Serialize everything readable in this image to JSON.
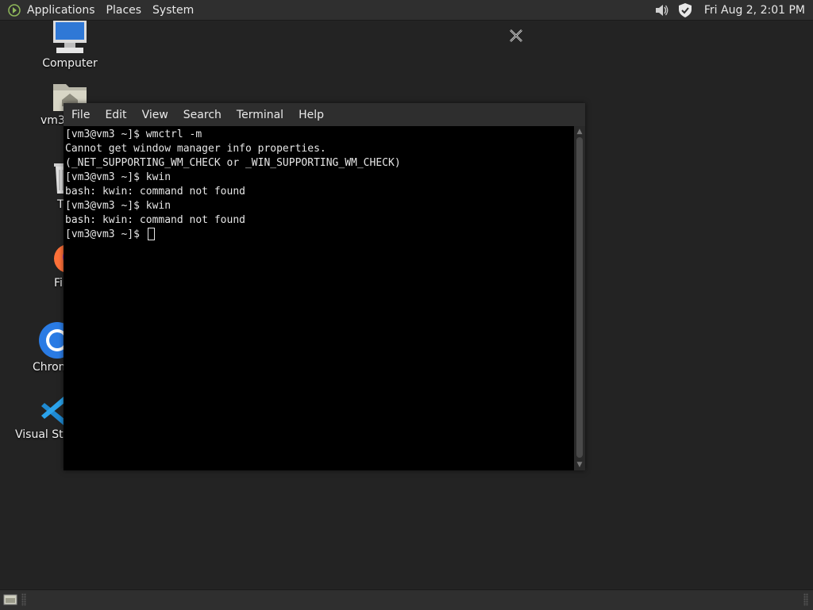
{
  "top_panel": {
    "menus": [
      "Applications",
      "Places",
      "System"
    ],
    "clock": "Fri Aug  2,  2:01 PM",
    "tray_icons": [
      "volume-icon",
      "shield-icon"
    ]
  },
  "desktop_icons": [
    {
      "label": "Computer",
      "icon": "computer-icon"
    },
    {
      "label": "vm3",
      "icon": "home-folder-icon"
    },
    {
      "label": "T",
      "icon": "trash-icon"
    },
    {
      "label": "Fi",
      "icon": "firefox-icon"
    },
    {
      "label": "Chrom",
      "icon": "chrome-icon"
    },
    {
      "label": "Visual Stud",
      "icon": "vscode-icon"
    }
  ],
  "terminal": {
    "menu": [
      "File",
      "Edit",
      "View",
      "Search",
      "Terminal",
      "Help"
    ],
    "lines": [
      "[vm3@vm3 ~]$ wmctrl -m",
      "Cannot get window manager info properties.",
      "(_NET_SUPPORTING_WM_CHECK or _WIN_SUPPORTING_WM_CHECK)",
      "[vm3@vm3 ~]$ kwin",
      "bash: kwin: command not found",
      "[vm3@vm3 ~]$ kwin",
      "bash: kwin: command not found"
    ],
    "prompt": "[vm3@vm3 ~]$ "
  },
  "colors": {
    "desktop_bg": "#232323",
    "panel_bg": "#2f2f2f",
    "terminal_bg": "#000000",
    "terminal_fg": "#e6e6e6"
  }
}
